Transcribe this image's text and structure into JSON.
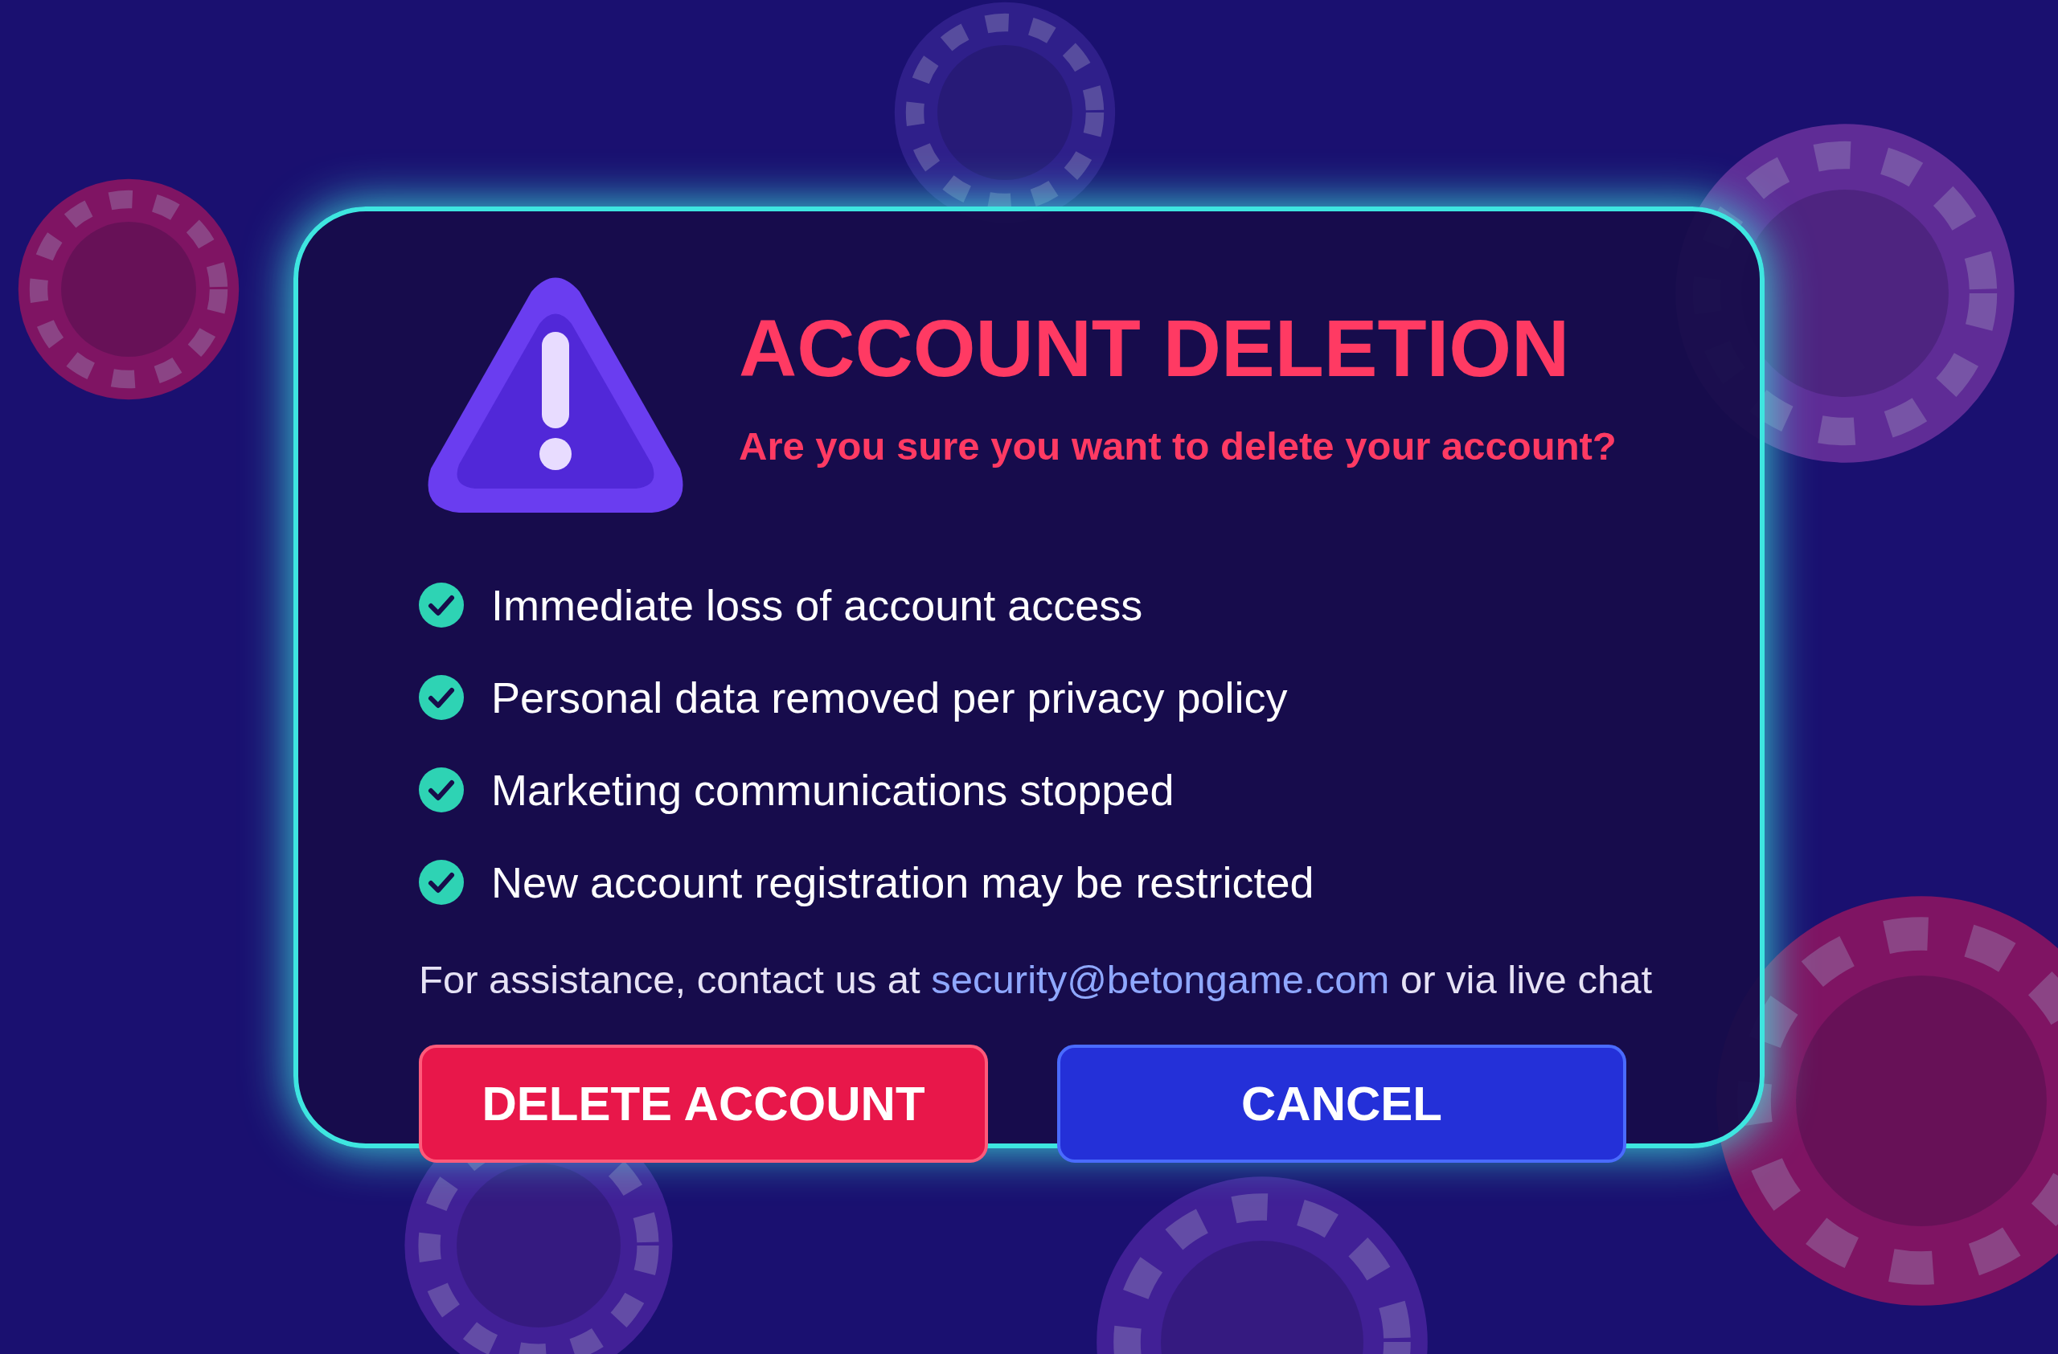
{
  "dialog": {
    "title": "ACCOUNT DELETION",
    "subtitle": "Are you sure you want to delete your account?",
    "consequences": [
      {
        "text": "Immediate loss of account access",
        "checked": true
      },
      {
        "text": "Personal data removed per privacy policy",
        "checked": true
      },
      {
        "text": "Marketing communications stopped",
        "checked": true
      },
      {
        "text": "New account registration may be restricted",
        "checked": true
      }
    ],
    "help": {
      "before": "For assistance, contact us at",
      "link": "security@betongame.com",
      "after": "or via live chat"
    },
    "buttons": [
      {
        "label": "DELETE ACCOUNT",
        "kind": "danger"
      },
      {
        "label": "CANCEL",
        "kind": "secondary"
      }
    ]
  }
}
